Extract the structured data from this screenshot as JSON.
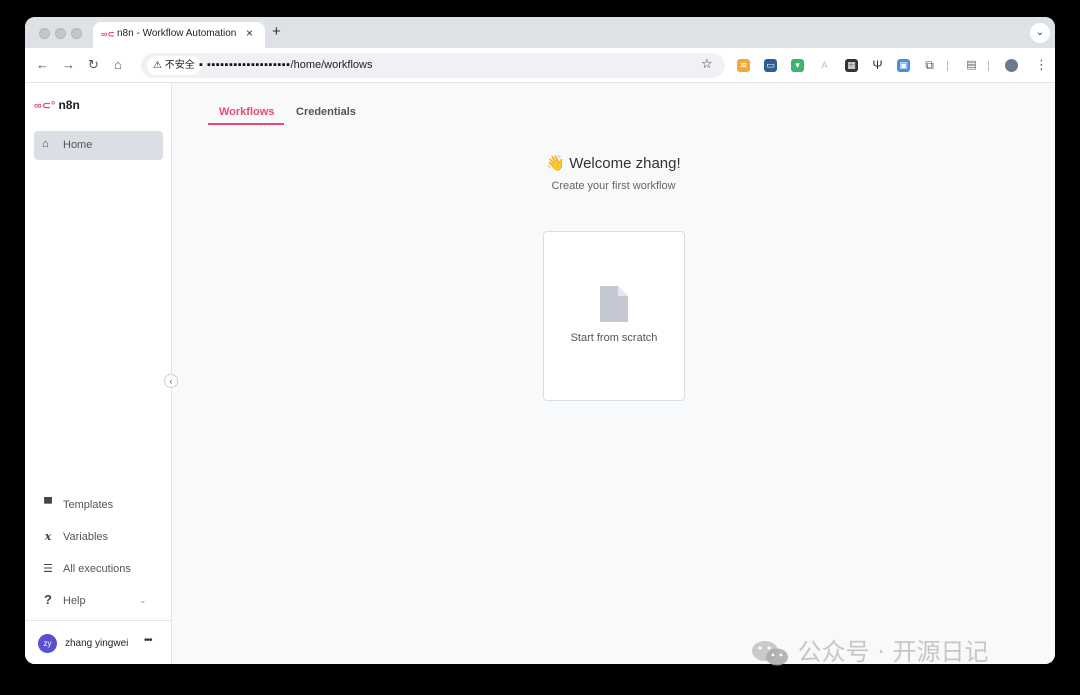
{
  "browser": {
    "tab_title": "n8n - Workflow Automation",
    "tab_favicon": "n8n-logo-icon",
    "new_tab": "+",
    "close_tab": "×",
    "security_label": "⚠ 不安全",
    "url_host": "▪ ▪▪▪▪▪▪▪▪▪▪▪▪▪▪▪▪▪▪▪",
    "url_path": "/home/workflows"
  },
  "sidebar": {
    "brand": "n8n",
    "home_label": "Home",
    "items": [
      {
        "label": "Templates",
        "icon": "box-icon"
      },
      {
        "label": "Variables",
        "icon": "variable-icon"
      },
      {
        "label": "All executions",
        "icon": "tasks-icon"
      },
      {
        "label": "Help",
        "icon": "question-icon"
      }
    ],
    "user": {
      "initials": "zy",
      "name": "zhang yingwei",
      "more": "•••"
    }
  },
  "main": {
    "tabs": [
      {
        "label": "Workflows",
        "active": true
      },
      {
        "label": "Credentials",
        "active": false
      }
    ],
    "welcome": "👋 Welcome zhang!",
    "subtitle": "Create your first workflow",
    "scratch_card": "Start from scratch"
  },
  "watermark": "公众号 · 开源日记",
  "colors": {
    "accent": "#ea4b71",
    "avatar": "#5a4fcf",
    "active_nav": "#dadee5"
  }
}
